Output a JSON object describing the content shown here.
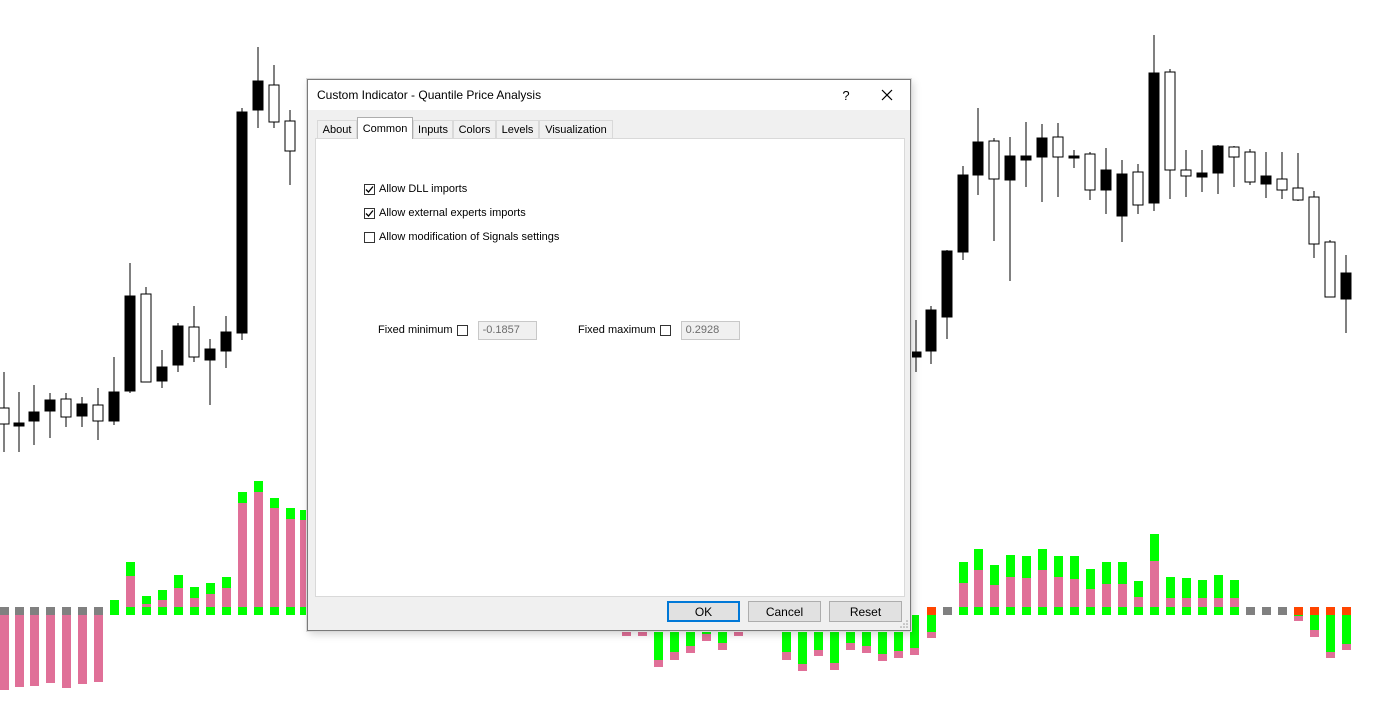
{
  "dialog": {
    "title": "Custom Indicator - Quantile Price Analysis",
    "help_label": "?",
    "tabs": [
      {
        "label": "About",
        "active": false
      },
      {
        "label": "Common",
        "active": true
      },
      {
        "label": "Inputs",
        "active": false
      },
      {
        "label": "Colors",
        "active": false
      },
      {
        "label": "Levels",
        "active": false
      },
      {
        "label": "Visualization",
        "active": false
      }
    ],
    "checkboxes": [
      {
        "label": "Allow DLL imports",
        "checked": true
      },
      {
        "label": "Allow external experts imports",
        "checked": true
      },
      {
        "label": "Allow modification of Signals settings",
        "checked": false
      }
    ],
    "fixed_minimum": {
      "label": "Fixed minimum",
      "checked": false,
      "value": "-0.1857"
    },
    "fixed_maximum": {
      "label": "Fixed maximum",
      "checked": false,
      "value": "0.2928"
    },
    "buttons": {
      "ok": "OK",
      "cancel": "Cancel",
      "reset": "Reset"
    }
  },
  "colors": {
    "bull_candle": "#ffffff",
    "bear_candle": "#000000",
    "hist_green": "#00ff00",
    "hist_pink": "#e07098",
    "hist_gray": "#808080",
    "hist_red": "#ff4500"
  }
}
